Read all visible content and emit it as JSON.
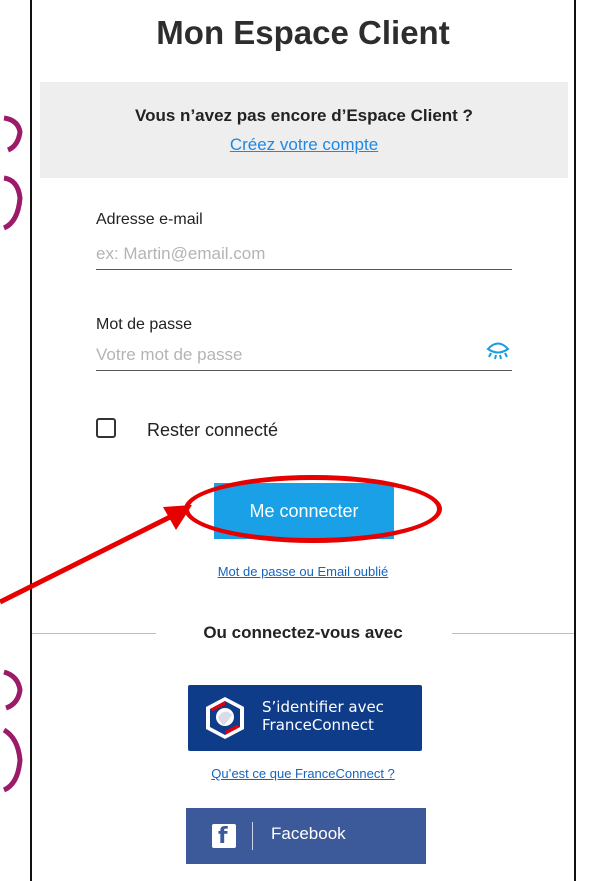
{
  "title": "Mon Espace Client",
  "signup": {
    "question": "Vous n’avez pas encore d’Espace Client ?",
    "link": "Créez votre compte"
  },
  "email": {
    "label": "Adresse e-mail",
    "placeholder": "ex: Martin@email.com",
    "value": ""
  },
  "password": {
    "label": "Mot de passe",
    "placeholder": "Votre mot de passe",
    "value": "",
    "toggle_icon": "eye-icon"
  },
  "remember": {
    "label": "Rester connecté",
    "checked": false
  },
  "login_button": "Me connecter",
  "forgot_link": "Mot de passe ou Email oublié",
  "separator": "Ou connectez-vous avec",
  "franceconnect": {
    "line1": "S’identifier avec",
    "line2": "FranceConnect",
    "info_link": "Qu’est ce que FranceConnect ?"
  },
  "facebook": {
    "label": "Facebook",
    "icon": "facebook-icon"
  },
  "colors": {
    "primary_button": "#19a0e6",
    "link": "#1e88e5",
    "franceconnect_bg": "#0e3c88",
    "facebook_bg": "#3c5a99",
    "annotation_red": "#e60000",
    "side_marks": "#9c1a6a"
  }
}
